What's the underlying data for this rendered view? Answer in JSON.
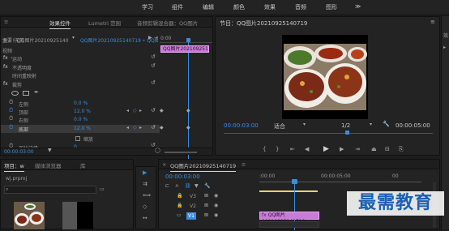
{
  "menu": {
    "items": [
      "学习",
      "组件",
      "编辑",
      "颜色",
      "效果",
      "音频",
      "图形"
    ],
    "more": "≫"
  },
  "effect_controls": {
    "tabs": [
      "效果控件",
      "Lumetri 范围",
      "音频剪辑混合器：QQ图片"
    ],
    "source_label": "源・（无剪辑）",
    "clip_path": "主要・QQ图片2021092514071...",
    "sequence_clip": "QQ图片20210925140719 • QQ图片2021...",
    "ruler_time": "0:00",
    "clip_name": "QQ图片202109251",
    "section_video": "视频",
    "properties": [
      {
        "fx": "fx",
        "name": "运动"
      },
      {
        "fx": "fx",
        "name": "不透明度"
      },
      {
        "fx": "",
        "name": "时间重映射"
      },
      {
        "fx": "fx",
        "name": "裁剪"
      }
    ],
    "crop_rows": [
      {
        "name": "左侧",
        "value": "0.0 %"
      },
      {
        "name": "顶部",
        "value": "12.0 %"
      },
      {
        "name": "右侧",
        "value": "0.0 %"
      },
      {
        "name": "底部",
        "value": "12.0 %"
      }
    ],
    "zoom_label": "缩放",
    "edge_feather": {
      "name": "羽化边缘",
      "value": "0"
    },
    "bottom_time": "00:00:03:00"
  },
  "program": {
    "title": "节目：QQ图片20210925140719",
    "timecode": "00:00:03:00",
    "fit": "适合",
    "resolution": "1/2",
    "duration": "00:00:05:00"
  },
  "project": {
    "tabs": [
      "项目：w",
      "媒体浏览器",
      "库"
    ],
    "file": "wj.prproj"
  },
  "timeline": {
    "title": "QQ图片20210925140719",
    "timecode": "00:00:03:00",
    "ruler_start": ":00:00",
    "ruler_mid": "00:00:05:00",
    "ruler_end": "00",
    "tracks": [
      {
        "id": "V3",
        "label": "V3"
      },
      {
        "id": "V2",
        "label": "V2"
      },
      {
        "id": "V1",
        "label": "V1"
      }
    ],
    "clip_label": "QQ图片20210925140719",
    "clip_fx": "fx"
  },
  "watermark": {
    "text": "最需教育"
  },
  "colors": {
    "accent": "#3b8de0",
    "clip": "#c97bd8",
    "yellow": "#e8d36a"
  }
}
